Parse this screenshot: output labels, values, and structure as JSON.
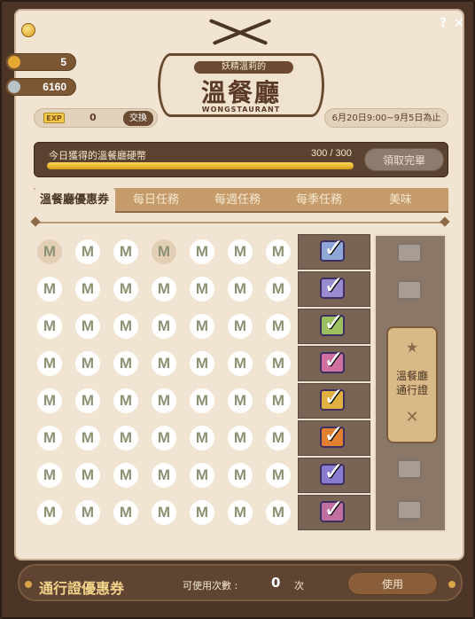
{
  "window": {
    "help_label": "?",
    "close_label": "×"
  },
  "currencies": [
    {
      "name": "gold-coin",
      "color": "#e6a632",
      "value": "5"
    },
    {
      "name": "silver-coin",
      "color": "#b7c3c9",
      "value": "6160"
    }
  ],
  "header": {
    "subtitle": "妖精溫莉的",
    "title": "溫餐廳",
    "english": "WONGSTAURANT"
  },
  "exp": {
    "tag": "EXP",
    "value": "0",
    "exchange_label": "交換"
  },
  "period": "6月20日9:00~9月5日為止",
  "coin_progress": {
    "label": "今日獲得的溫餐廳硬幣",
    "count_text": "300 / 300",
    "fraction": 1.0,
    "claim_label": "領取完畢"
  },
  "tabs": [
    {
      "label": "溫餐廳優惠券",
      "active": true
    },
    {
      "label": "每日任務",
      "active": false
    },
    {
      "label": "每週任務",
      "active": false
    },
    {
      "label": "每季任務",
      "active": false
    },
    {
      "label": "美味",
      "active": false
    }
  ],
  "stamp_glyph": "M",
  "rows": [
    {
      "stamps": [
        "tan",
        "white",
        "white",
        "tan",
        "white",
        "white",
        "white"
      ],
      "reward_icon": "ticket-icon",
      "reward_color": "#8fa7d8",
      "checked": true
    },
    {
      "stamps": [
        "white",
        "white",
        "white",
        "white",
        "white",
        "white",
        "white"
      ],
      "reward_icon": "mystery-box-icon",
      "reward_color": "#9a8ad0",
      "checked": true
    },
    {
      "stamps": [
        "white",
        "white",
        "white",
        "white",
        "white",
        "white",
        "white"
      ],
      "reward_icon": "shield-icon",
      "reward_color": "#9cc060",
      "checked": true
    },
    {
      "stamps": [
        "white",
        "white",
        "white",
        "white",
        "white",
        "white",
        "white"
      ],
      "reward_icon": "scroll-icon",
      "reward_color": "#d070a0",
      "checked": true
    },
    {
      "stamps": [
        "white",
        "white",
        "white",
        "white",
        "white",
        "white",
        "white"
      ],
      "reward_icon": "ticket-icon",
      "reward_color": "#e0b040",
      "checked": true
    },
    {
      "stamps": [
        "white",
        "white",
        "white",
        "white",
        "white",
        "white",
        "white"
      ],
      "reward_icon": "shield-icon",
      "reward_color": "#e08030",
      "checked": true
    },
    {
      "stamps": [
        "white",
        "white",
        "white",
        "white",
        "white",
        "white",
        "white"
      ],
      "reward_icon": "mystery-box-icon",
      "reward_color": "#8a7ad0",
      "checked": true
    },
    {
      "stamps": [
        "white",
        "white",
        "white",
        "white",
        "white",
        "white",
        "white"
      ],
      "reward_icon": "scroll-icon",
      "reward_color": "#c070a0",
      "checked": true
    }
  ],
  "pass_card": {
    "star": "★",
    "label_line1": "溫餐廳",
    "label_line2": "通行證",
    "cross": "✕"
  },
  "bottom": {
    "title": "通行證優惠券",
    "uses_label": "可使用次數 :",
    "uses_value": "0",
    "uses_unit": "次",
    "use_button": "使用"
  }
}
